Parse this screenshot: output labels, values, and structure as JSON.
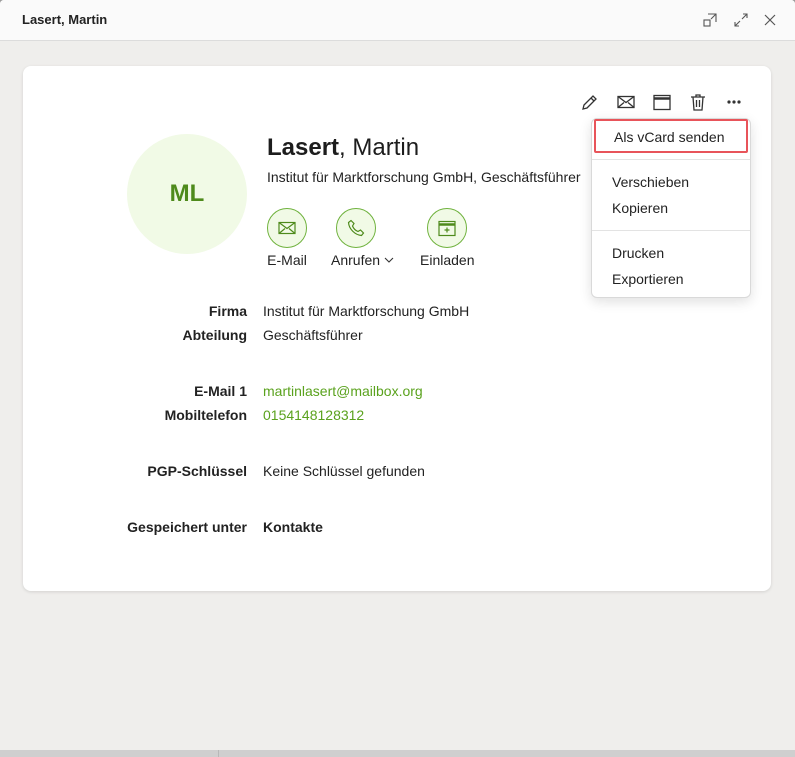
{
  "window": {
    "title": "Lasert, Martin",
    "controls": [
      "detach-icon",
      "expand-icon",
      "close-icon"
    ]
  },
  "toolbar": {
    "icons": [
      "edit-icon",
      "mail-icon",
      "calendar-icon",
      "trash-icon",
      "more-icon"
    ]
  },
  "contact": {
    "initials": "ML",
    "last_name": "Lasert",
    "name_separator": ", ",
    "first_name": "Martin",
    "subtitle": "Institut für Marktforschung GmbH, Geschäftsführer"
  },
  "actions": [
    {
      "label": "E-Mail",
      "icon": "mail-icon"
    },
    {
      "label": "Anrufen",
      "icon": "phone-icon",
      "has_dropdown": true
    },
    {
      "label": "Einladen",
      "icon": "calendar-add-icon"
    }
  ],
  "fields": {
    "company": {
      "label": "Firma",
      "value": "Institut für Marktforschung GmbH"
    },
    "department": {
      "label": "Abteilung",
      "value": "Geschäftsführer"
    },
    "email1": {
      "label": "E-Mail 1",
      "value": "martinlasert@mailbox.org"
    },
    "mobile": {
      "label": "Mobiltelefon",
      "value": "0154148128312"
    },
    "pgp": {
      "label": "PGP-Schlüssel",
      "value": "Keine Schlüssel gefunden"
    },
    "saved_in": {
      "label": "Gespeichert unter",
      "value": "Kontakte"
    }
  },
  "menu": {
    "items": [
      {
        "label": "Als vCard senden",
        "focused": true
      },
      {
        "label": "Verschieben"
      },
      {
        "label": "Kopieren"
      },
      {
        "label": "Drucken"
      },
      {
        "label": "Exportieren"
      }
    ]
  },
  "colors": {
    "accent": "#5aa21d",
    "avatar_bg": "#f1fae6",
    "avatar_text": "#4e8a1b",
    "focus_ring": "#e8545a"
  }
}
